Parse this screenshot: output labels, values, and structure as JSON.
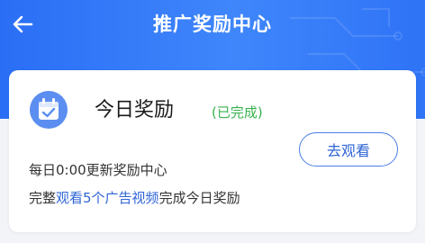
{
  "header": {
    "title": "推广奖励中心",
    "back_icon": "back-arrow-icon"
  },
  "card": {
    "icon": "calendar-check-icon",
    "title": "今日奖励",
    "status": "(已完成)",
    "action_label": "去观看",
    "refresh_text": "每日0:00更新奖励中心",
    "desc_prefix": "完整",
    "desc_highlight": "观看5个广告视频",
    "desc_suffix": "完成今日奖励"
  },
  "colors": {
    "header_blue": "#3f86fb",
    "status_green": "#37b24d",
    "accent_blue": "#2f64d6"
  }
}
